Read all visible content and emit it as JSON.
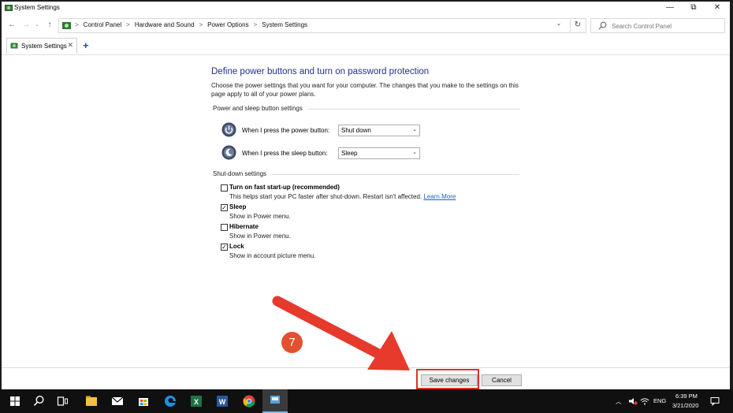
{
  "window": {
    "title": "System Settings",
    "buttons": {
      "minimize": "—",
      "maximize": "⧉",
      "close": "✕"
    }
  },
  "address": {
    "crumbs": [
      "Control Panel",
      "Hardware and Sound",
      "Power Options",
      "System Settings"
    ],
    "separator": ">"
  },
  "search": {
    "placeholder": "Search Control Panel"
  },
  "tab": {
    "label": "System Settings",
    "close": "✕",
    "new": "+"
  },
  "content": {
    "heading": "Define power buttons and turn on password protection",
    "description": "Choose the power settings that you want for your computer. The changes that you make to the settings on this page apply to all of your power plans.",
    "power_group": {
      "title": "Power and sleep button settings",
      "power_button": {
        "label": "When I press the power button:",
        "value": "Shut down"
      },
      "sleep_button": {
        "label": "When I press the sleep button:",
        "value": "Sleep"
      }
    },
    "shutdown_group": {
      "title": "Shut-down settings",
      "items": [
        {
          "label": "Turn on fast start-up (recommended)",
          "sub": "This helps start your PC faster after shut-down. Restart isn't affected.",
          "link": "Learn More",
          "checked": false
        },
        {
          "label": "Sleep",
          "sub": "Show in Power menu.",
          "checked": true
        },
        {
          "label": "Hibernate",
          "sub": "Show in Power menu.",
          "checked": false
        },
        {
          "label": "Lock",
          "sub": "Show in account picture menu.",
          "checked": true
        }
      ]
    }
  },
  "footer": {
    "save_label": "Save changes",
    "cancel_label": "Cancel"
  },
  "annotation": {
    "step": "7",
    "color": "#e0302a"
  },
  "taskbar": {
    "tray": {
      "language": "ENG",
      "time": "6:39 PM",
      "date": "3/21/2020"
    }
  }
}
